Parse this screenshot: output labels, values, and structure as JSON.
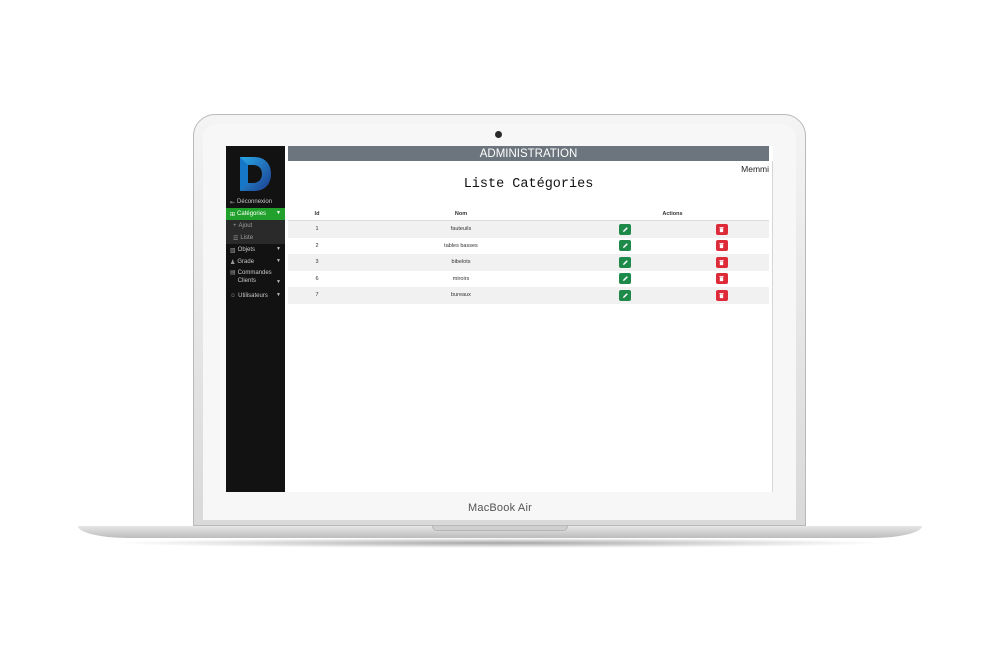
{
  "device": {
    "label": "MacBook Air"
  },
  "sidebar": {
    "items": [
      {
        "label": "Déconnexion",
        "icon": "sign-out-icon"
      },
      {
        "label": "Catégories",
        "icon": "plus-square-icon",
        "active": true
      },
      {
        "label": "Ajout",
        "icon": "plus-icon",
        "sub": true
      },
      {
        "label": "Liste",
        "icon": "list-icon",
        "sub": true
      },
      {
        "label": "Objets",
        "icon": "objects-icon"
      },
      {
        "label": "Grade",
        "icon": "user-tie-icon"
      },
      {
        "label": "Commandes Clients",
        "icon": "cart-icon"
      },
      {
        "label": "Utilisateurs",
        "icon": "users-icon"
      }
    ],
    "accent_color": "#1fa12b"
  },
  "header": {
    "title": "ADMINISTRATION",
    "bg_color": "#6c757d",
    "user": "Memmi"
  },
  "page": {
    "title": "Liste Catégories"
  },
  "table": {
    "columns": [
      "Id",
      "Nom",
      "Actions"
    ],
    "rows": [
      {
        "id": "1",
        "nom": "fauteuils"
      },
      {
        "id": "2",
        "nom": "tables basses"
      },
      {
        "id": "3",
        "nom": "bibelots"
      },
      {
        "id": "6",
        "nom": "miroirs"
      },
      {
        "id": "7",
        "nom": "bureaux"
      }
    ],
    "edit_color": "#1e8a4a",
    "delete_color": "#de2b3a"
  }
}
